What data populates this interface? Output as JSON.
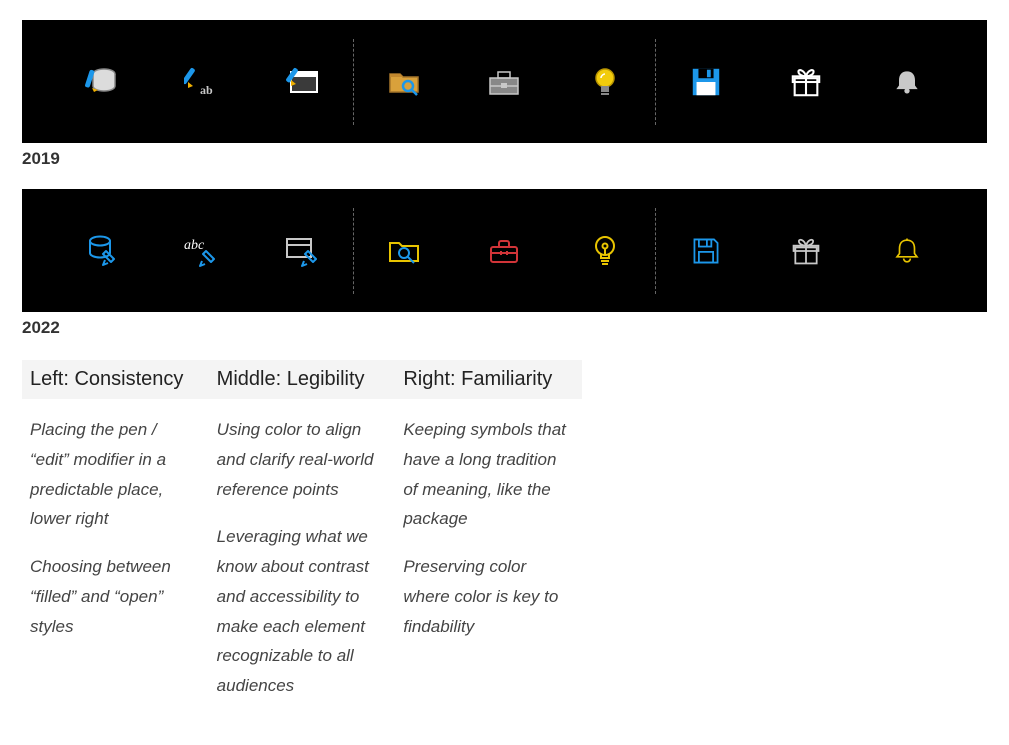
{
  "rows": [
    {
      "year": "2019"
    },
    {
      "year": "2022"
    }
  ],
  "principles": {
    "headers": {
      "left": "Left: Consistency",
      "middle": "Middle: Legibility",
      "right": "Right: Familiarity"
    },
    "left": {
      "p1": "Placing the pen / “edit” modifier in a predictable place, lower right",
      "p2": "Choosing between “filled” and “open” styles"
    },
    "middle": {
      "p1": "Using color to align and clarify real-world reference points",
      "p2": "Leveraging what we know about contrast and accessibility to make each element recognizable to all audiences"
    },
    "right": {
      "p1": "Keeping symbols that have a long tradition of meaning, like the package",
      "p2": "Preserving color where color is key to findability"
    }
  },
  "colors": {
    "blue": "#1c97ea",
    "yellow": "#e8c400",
    "red": "#d13438",
    "grey": "#c8c8c8",
    "white": "#ffffff"
  }
}
